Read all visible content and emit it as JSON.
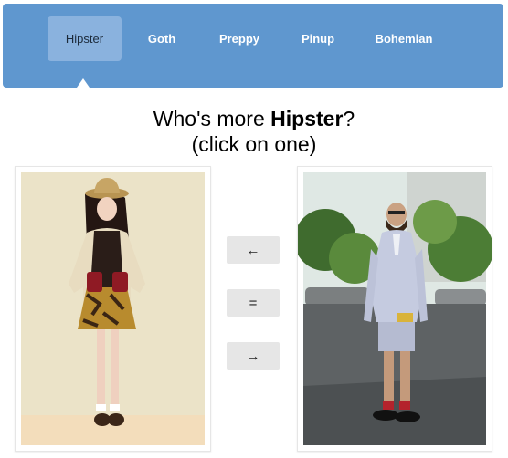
{
  "nav": {
    "tabs": [
      {
        "label": "Hipster",
        "active": true
      },
      {
        "label": "Goth",
        "active": false
      },
      {
        "label": "Preppy",
        "active": false
      },
      {
        "label": "Pinup",
        "active": false
      },
      {
        "label": "Bohemian",
        "active": false
      }
    ]
  },
  "prompt": {
    "prefix": "Who's more ",
    "style": "Hipster",
    "suffix": "?",
    "instruction": "(click on one)"
  },
  "buttons": {
    "left": "←",
    "equal": "=",
    "right": "→"
  },
  "colors": {
    "navbar": "#5f97cf",
    "active_tab": "#8ab2de",
    "button_bg": "#e6e6e6"
  }
}
